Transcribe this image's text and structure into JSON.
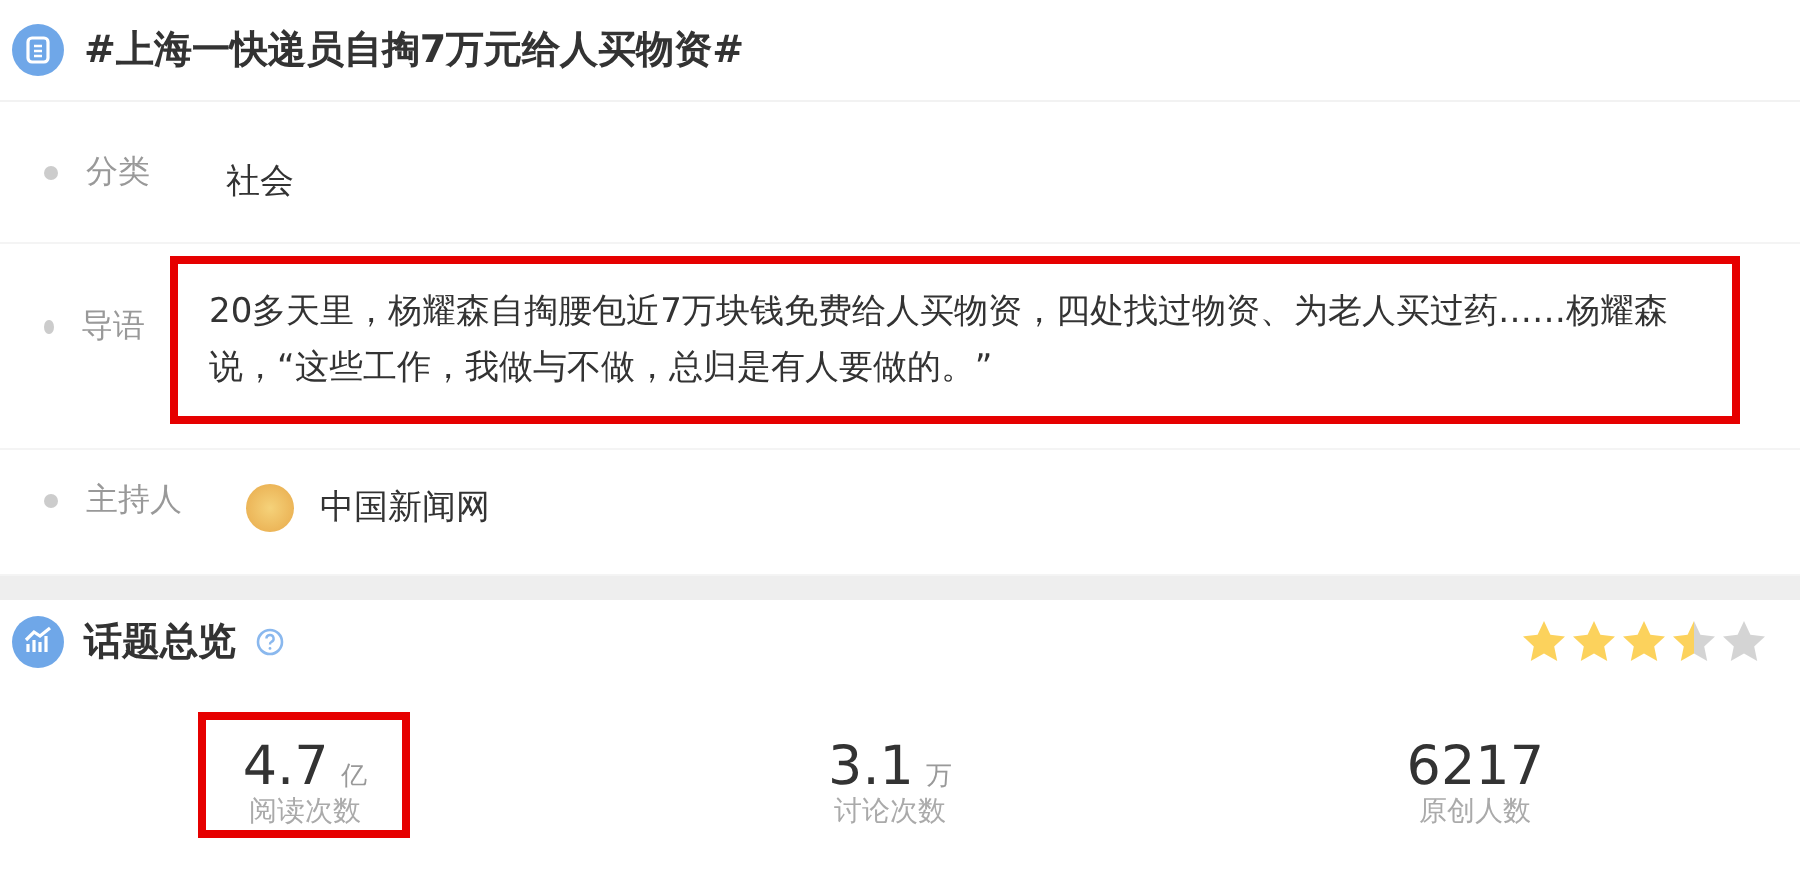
{
  "title": "#上海一快递员自掏7万元给人买物资#",
  "info_rows": [
    {
      "kind": "text",
      "label": "分类",
      "value": "社会",
      "highlighted": false
    },
    {
      "kind": "text",
      "label": "导语",
      "value": "20多天里，杨耀森自掏腰包近7万块钱免费给人买物资，四处找过物资、为老人买过药……杨耀森说，“这些工作，我做与不做，总归是有人要做的。”",
      "highlighted": true
    },
    {
      "kind": "host",
      "label": "主持人",
      "value": "中国新闻网",
      "highlighted": false
    }
  ],
  "overview": {
    "title": "话题总览",
    "stars": 3.5,
    "stats": [
      {
        "value": "4.7",
        "unit": "亿",
        "label": "阅读次数",
        "highlighted": true
      },
      {
        "value": "3.1",
        "unit": "万",
        "label": "讨论次数",
        "highlighted": false
      },
      {
        "value": "6217",
        "label": "原创人数",
        "highlighted": false
      }
    ]
  }
}
